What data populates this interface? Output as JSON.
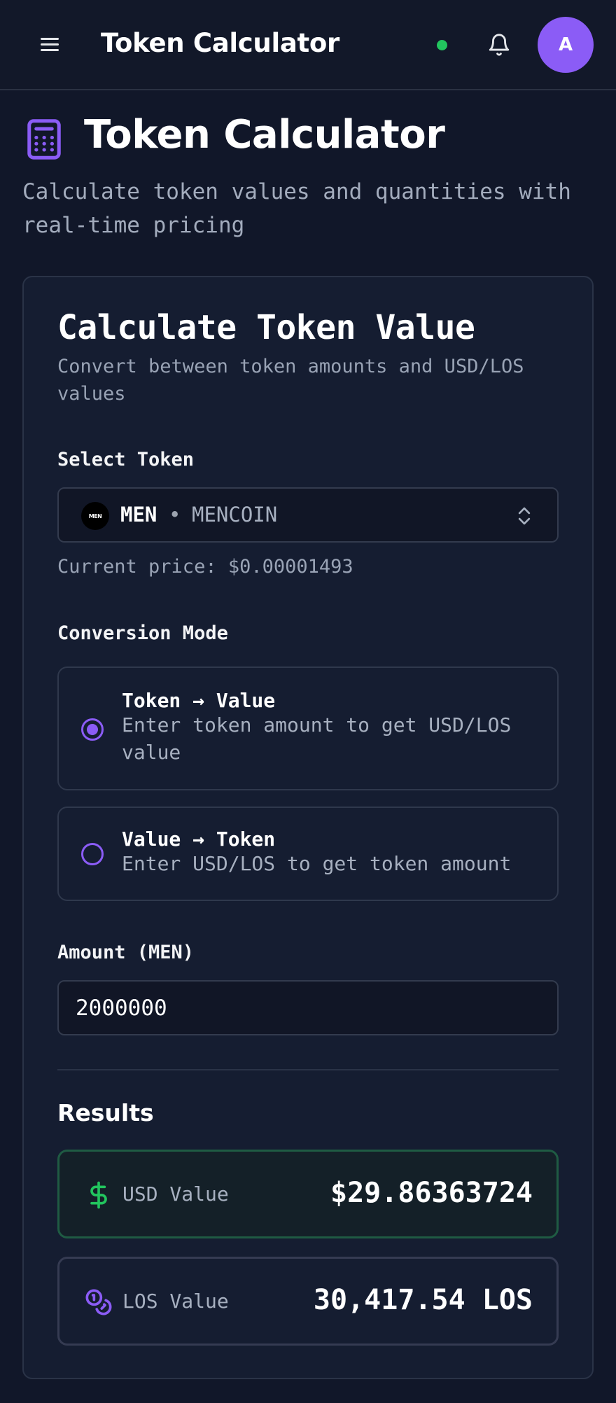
{
  "header": {
    "title": "Token Calculator",
    "avatar_initial": "A"
  },
  "page": {
    "title": "Token Calculator",
    "subtitle": "Calculate token values and quantities with real-time pricing"
  },
  "card": {
    "title": "Calculate Token Value",
    "subtitle": "Convert between token amounts and USD/LOS values"
  },
  "token_select": {
    "label": "Select Token",
    "logo_text": "MEN",
    "symbol": "MEN",
    "separator": "•",
    "name": "MENCOIN",
    "price_text": "Current price: $0.00001493"
  },
  "conversion": {
    "label": "Conversion Mode",
    "options": [
      {
        "title": "Token → Value",
        "description": "Enter token amount to get USD/LOS value",
        "selected": true
      },
      {
        "title": "Value → Token",
        "description": "Enter USD/LOS to get token amount",
        "selected": false
      }
    ]
  },
  "amount": {
    "label": "Amount (MEN)",
    "value": "2000000"
  },
  "results": {
    "title": "Results",
    "usd": {
      "label": "USD Value",
      "value": "$29.86363724"
    },
    "los": {
      "label": "LOS Value",
      "value": "30,417.54 LOS"
    }
  },
  "colors": {
    "accent": "#8b5cf6",
    "status_online": "#22c55e",
    "usd_icon": "#22c55e",
    "background": "#111729"
  },
  "icons": {
    "menu": "hamburger-icon",
    "notification": "bell-icon",
    "page": "calculator-icon",
    "select": "chevron-up-down-icon",
    "usd": "dollar-icon",
    "los": "coins-icon"
  }
}
